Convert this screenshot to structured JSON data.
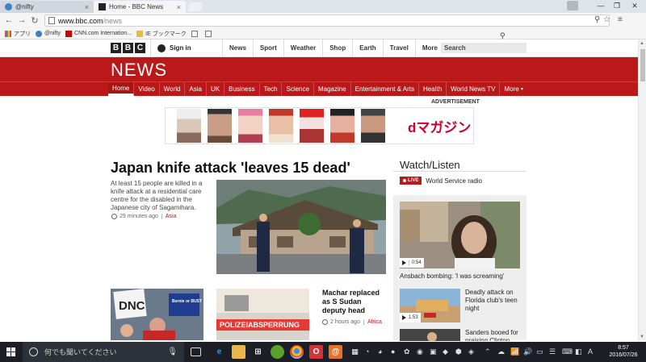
{
  "browser": {
    "tabs": [
      {
        "title": "@nifty",
        "active": false
      },
      {
        "title": "Home - BBC News",
        "active": true
      }
    ],
    "url_host": "www.bbc.com",
    "url_path": "/news",
    "bookmarks": [
      "アプリ",
      "@nifty",
      "CNN.com Internation...",
      "IE ブックマーク"
    ]
  },
  "bbc": {
    "logo_letters": [
      "B",
      "B",
      "C"
    ],
    "signin": "Sign in",
    "top_nav": [
      "News",
      "Sport",
      "Weather",
      "Shop",
      "Earth",
      "Travel"
    ],
    "more": "More",
    "search_placeholder": "Search",
    "news_title": "NEWS",
    "nav": [
      "Home",
      "Video",
      "World",
      "Asia",
      "UK",
      "Business",
      "Tech",
      "Science",
      "Magazine",
      "Entertainment & Arts",
      "Health",
      "World News TV"
    ],
    "nav_more": "More",
    "active_nav": "Home"
  },
  "ad": {
    "label": "ADVERTISEMENT",
    "brand": "dマガジン"
  },
  "main_story": {
    "headline": "Japan knife attack 'leaves 15 dead'",
    "summary": "At least 15 people are killed in a knife attack at a residential care centre for the disabled in the Japanese city of Sagamihara.",
    "time": "29 minutes ago",
    "category": "Asia"
  },
  "watch_listen": {
    "title": "Watch/Listen",
    "live_badge": "LIVE",
    "live_label": "World Service radio",
    "video_duration": "0:54",
    "video_caption": "Ansbach bombing: 'I was screaming'",
    "items": [
      {
        "text": "Deadly attack on Florida club's teen night",
        "duration": "1:53"
      },
      {
        "text": "Sanders booed for praising Clinton",
        "duration": ""
      }
    ]
  },
  "lower_story": {
    "headline": "Machar replaced as S Sudan deputy head",
    "time": "2 hours ago",
    "category": "Africa",
    "dnc_sign": "DNC",
    "bernie_sign": "Bernie or BUST",
    "police_tape": "POLIZEIABSPERRUNG"
  },
  "taskbar": {
    "search_placeholder": "何でも聞いてください",
    "time": "8:57",
    "date": "2016/07/26"
  },
  "colors": {
    "bbc_red": "#bb1919",
    "taskbar": "#1c1f26"
  }
}
